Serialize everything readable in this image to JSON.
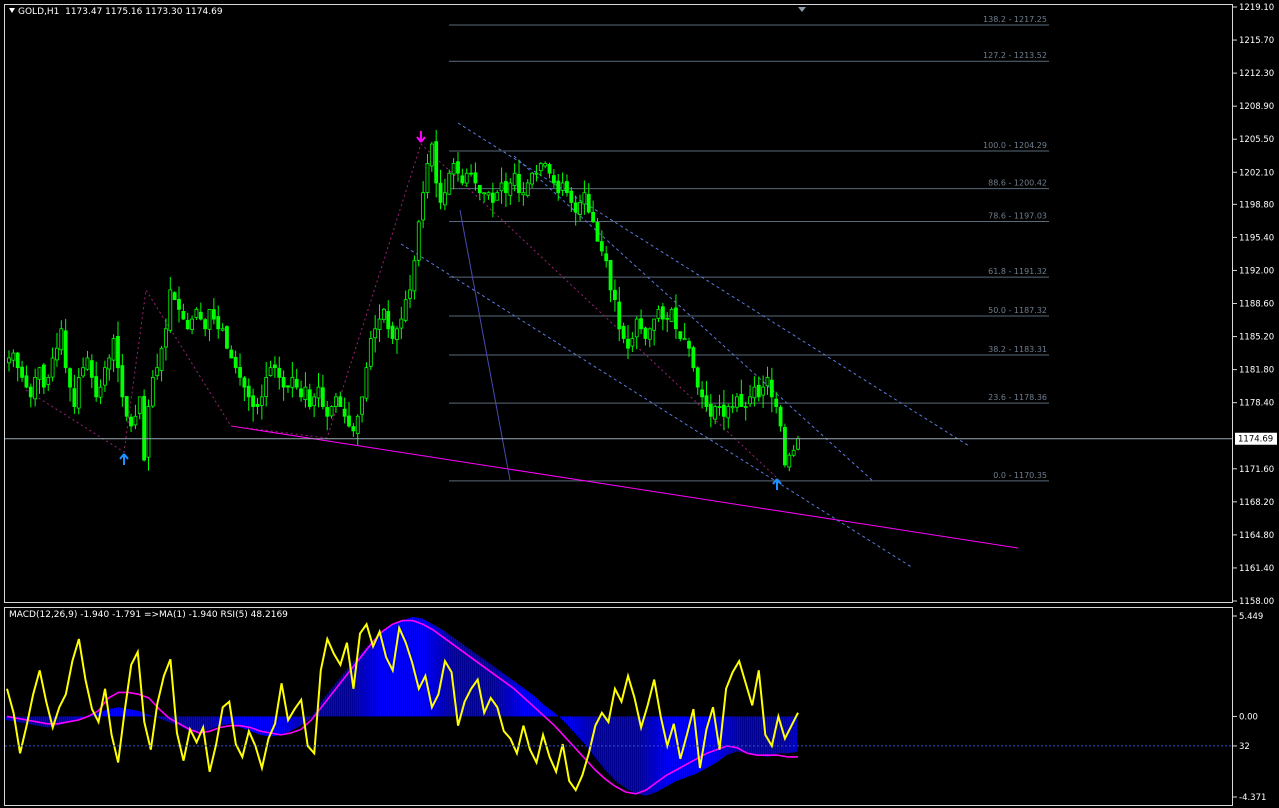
{
  "header": {
    "symbol": "GOLD,H1",
    "ohlc": "1173.47 1175.16 1173.30 1174.69"
  },
  "price_axis": {
    "labels": [
      "1219.10",
      "1215.70",
      "1212.30",
      "1208.90",
      "1205.50",
      "1202.10",
      "1198.80",
      "1195.40",
      "1192.00",
      "1188.60",
      "1185.20",
      "1181.80",
      "1178.40",
      "1171.60",
      "1168.20",
      "1164.80",
      "1161.40",
      "1158.00"
    ],
    "current_price_label": "1174.69"
  },
  "fibo_levels": [
    {
      "label": "138.2 - 1217.25",
      "price": 1217.25
    },
    {
      "label": "127.2 - 1213.52",
      "price": 1213.52
    },
    {
      "label": "100.0 - 1204.29",
      "price": 1204.29
    },
    {
      "label": "88.6 - 1200.42",
      "price": 1200.42
    },
    {
      "label": "78.6 - 1197.03",
      "price": 1197.03
    },
    {
      "label": "61.8 - 1191.32",
      "price": 1191.32
    },
    {
      "label": "50.0 - 1187.32",
      "price": 1187.32
    },
    {
      "label": "38.2 - 1183.31",
      "price": 1183.31
    },
    {
      "label": "23.6 - 1178.36",
      "price": 1178.36
    },
    {
      "label": "0.0 - 1170.35",
      "price": 1170.35
    }
  ],
  "indicator": {
    "label": "MACD(12,26,9) -1.940 -1.791  =>MA(1) -1.940  RSI(5) 48.2169",
    "axis_labels": [
      "5.449",
      "0.00",
      "32",
      "-4.371"
    ]
  },
  "colors": {
    "bull_candle": "#00ff00",
    "bear_candle": "#00ff00",
    "macd_hist": "#0000ff",
    "signal_line": "#ff00ff",
    "rsi_line": "#ffff00",
    "fib_lines": "#5a6a78",
    "channel": "#5a7ae0",
    "trendline": "#ff00ff",
    "arrow_up": "#1e90ff",
    "arrow_down": "#ff00ff"
  },
  "chart_data": {
    "type": "candlestick",
    "title": "GOLD,H1",
    "ylim": [
      1158.0,
      1219.1
    ],
    "last_price": 1174.69,
    "open": 1173.47,
    "high": 1175.16,
    "low": 1173.3,
    "close": 1174.69,
    "close_path": [
      1183,
      1183.5,
      1182,
      1181,
      1180,
      1179,
      1181,
      1182,
      1180,
      1181,
      1183,
      1184,
      1186,
      1182,
      1180,
      1178,
      1181,
      1182,
      1183,
      1181,
      1179,
      1180,
      1182,
      1183,
      1185,
      1182,
      1179,
      1177,
      1176,
      1177,
      1179,
      1172.5,
      1178,
      1181,
      1182,
      1184,
      1186,
      1190,
      1189,
      1188,
      1187,
      1186,
      1187,
      1188,
      1187,
      1186,
      1188,
      1187,
      1186,
      1186,
      1184,
      1183,
      1182,
      1181,
      1180,
      1179,
      1178,
      1178,
      1179,
      1181,
      1182,
      1182,
      1181,
      1180,
      1180,
      1181,
      1180,
      1179,
      1180,
      1178,
      1179,
      1180,
      1178,
      1177,
      1178,
      1179,
      1178,
      1177,
      1176,
      1175.5,
      1177,
      1179,
      1182,
      1185,
      1186,
      1187,
      1188,
      1186,
      1185,
      1186,
      1187,
      1189,
      1190,
      1193,
      1197,
      1200,
      1203,
      1205,
      1201,
      1199,
      1200,
      1202,
      1203,
      1202,
      1201,
      1202,
      1202,
      1201,
      1200,
      1200,
      1200,
      1199,
      1200,
      1201,
      1200,
      1201,
      1202,
      1200,
      1200,
      1201,
      1202,
      1202,
      1203,
      1203,
      1202,
      1201,
      1200,
      1201,
      1200,
      1199,
      1198,
      1199,
      1200,
      1198,
      1197,
      1195,
      1194,
      1193,
      1190,
      1189,
      1186,
      1185,
      1184,
      1185,
      1187,
      1186,
      1185,
      1186,
      1187,
      1188,
      1187,
      1187,
      1188,
      1186,
      1185,
      1185,
      1184,
      1182,
      1180,
      1179,
      1178,
      1177,
      1178,
      1178,
      1177,
      1178,
      1178,
      1179,
      1178,
      1178,
      1179,
      1180,
      1179,
      1180,
      1181,
      1179,
      1178,
      1176,
      1172,
      1173,
      1173.5,
      1174.7
    ],
    "channel_lines": [
      {
        "from": [
          457,
          123
        ],
        "to": [
          968,
          446
        ]
      },
      {
        "from": [
          400,
          244
        ],
        "to": [
          912,
          568
        ]
      },
      {
        "from": [
          513,
          156
        ],
        "to": [
          873,
          482
        ]
      }
    ],
    "trendlines": [
      {
        "from": [
          230,
          426
        ],
        "to": [
          1017,
          548
        ]
      },
      {
        "from": [
          459,
          210
        ],
        "to": [
          509,
          480
        ]
      }
    ],
    "zigzag": [
      [
        25,
        390
      ],
      [
        123,
        452
      ],
      [
        145,
        290
      ],
      [
        230,
        426
      ],
      [
        326,
        438
      ],
      [
        420,
        144
      ],
      [
        776,
        478
      ]
    ],
    "arrows": [
      {
        "type": "up",
        "at": [
          123,
          460
        ]
      },
      {
        "type": "down",
        "at": [
          420,
          136
        ]
      },
      {
        "type": "up",
        "at": [
          776,
          485
        ]
      }
    ],
    "macd": {
      "ylim": [
        -4.371,
        5.449
      ],
      "histogram": [
        -0.2,
        -0.3,
        -0.4,
        -0.5,
        -0.6,
        -0.5,
        -0.3,
        -0.2,
        0,
        0.2,
        0.4,
        0.5,
        0.4,
        0.3,
        0.1,
        -0.1,
        -0.3,
        -0.5,
        -0.8,
        -0.9,
        -0.7,
        -0.5,
        -0.4,
        -0.6,
        -0.8,
        -1.0,
        -1.1,
        -1.0,
        -0.8,
        -0.5,
        -0.1,
        0.8,
        1.5,
        2.2,
        2.9,
        3.5,
        4.1,
        4.6,
        5.0,
        5.2,
        5.4,
        5.3,
        5.0,
        4.7,
        4.3,
        3.9,
        3.5,
        3.1,
        2.7,
        2.3,
        1.9,
        1.5,
        1.1,
        0.6,
        0.2,
        -0.3,
        -0.9,
        -1.5,
        -2.2,
        -2.9,
        -3.5,
        -3.9,
        -4.2,
        -4.3,
        -4.1,
        -3.8,
        -3.5,
        -3.3,
        -3.1,
        -2.8,
        -2.5,
        -2.1,
        -1.9,
        -2.0,
        -2.1,
        -2.2,
        -2.0,
        -2.0,
        -1.9
      ],
      "signal": [
        0,
        -0.1,
        -0.2,
        -0.3,
        -0.4,
        -0.4,
        -0.3,
        -0.2,
        0,
        0.3,
        1.0,
        1.3,
        1.3,
        1.2,
        1.0,
        0.4,
        -0.1,
        -0.4,
        -0.7,
        -0.9,
        -0.8,
        -0.6,
        -0.5,
        -0.5,
        -0.6,
        -0.8,
        -0.9,
        -1.0,
        -0.9,
        -0.7,
        -0.2,
        0.5,
        1.2,
        1.9,
        2.6,
        3.3,
        4.0,
        4.6,
        5.0,
        5.2,
        5.2,
        5.0,
        4.7,
        4.3,
        3.9,
        3.5,
        3.1,
        2.7,
        2.3,
        1.9,
        1.5,
        1.0,
        0.5,
        0.0,
        -0.5,
        -1.1,
        -1.7,
        -2.3,
        -2.9,
        -3.4,
        -3.8,
        -4.1,
        -4.2,
        -4.0,
        -3.6,
        -3.2,
        -2.9,
        -2.6,
        -2.3,
        -2.0,
        -1.8,
        -1.6,
        -1.7,
        -2.0,
        -2.1,
        -2.1,
        -2.1,
        -2.2,
        -2.2
      ]
    },
    "rsi_path": [
      1.5,
      0.2,
      -2.0,
      -0.5,
      1.2,
      2.5,
      0.8,
      -0.6,
      0.5,
      1.2,
      3.0,
      4.2,
      2.0,
      0.4,
      -0.3,
      1.5,
      -1.0,
      -2.5,
      0.3,
      2.8,
      3.5,
      -0.3,
      -1.8,
      0.7,
      2.2,
      3.1,
      -0.9,
      -2.4,
      -0.7,
      -1.4,
      -0.6,
      -3.0,
      -1.5,
      0.5,
      0.8,
      -1.5,
      -2.2,
      -0.8,
      -1.6,
      -2.8,
      -1.2,
      -0.4,
      1.8,
      -0.2,
      0.4,
      0.9,
      -1.6,
      -2.0,
      2.5,
      4.2,
      3.4,
      2.8,
      4.0,
      1.5,
      4.5,
      5.0,
      3.8,
      4.6,
      3.2,
      2.5,
      4.8,
      4.0,
      2.9,
      1.5,
      2.2,
      0.5,
      1.2,
      3.0,
      2.4,
      -0.5,
      0.8,
      1.5,
      2.0,
      0.2,
      1.0,
      0.5,
      -0.8,
      -1.2,
      -2.0,
      -0.5,
      -1.8,
      -2.5,
      -1.0,
      -2.2,
      -3.0,
      -1.5,
      -3.5,
      -4.0,
      -3.2,
      -2.0,
      -0.5,
      0.2,
      -0.3,
      1.5,
      0.8,
      2.2,
      1.0,
      -0.6,
      0.6,
      2.0,
      0.0,
      -1.6,
      -0.4,
      -2.3,
      -1.0,
      0.4,
      -2.8,
      -0.7,
      0.5,
      -1.8,
      1.5,
      2.4,
      3.0,
      1.8,
      0.6,
      2.5,
      -1.0,
      -1.6,
      0.0,
      -1.2,
      -0.5,
      0.2
    ]
  }
}
